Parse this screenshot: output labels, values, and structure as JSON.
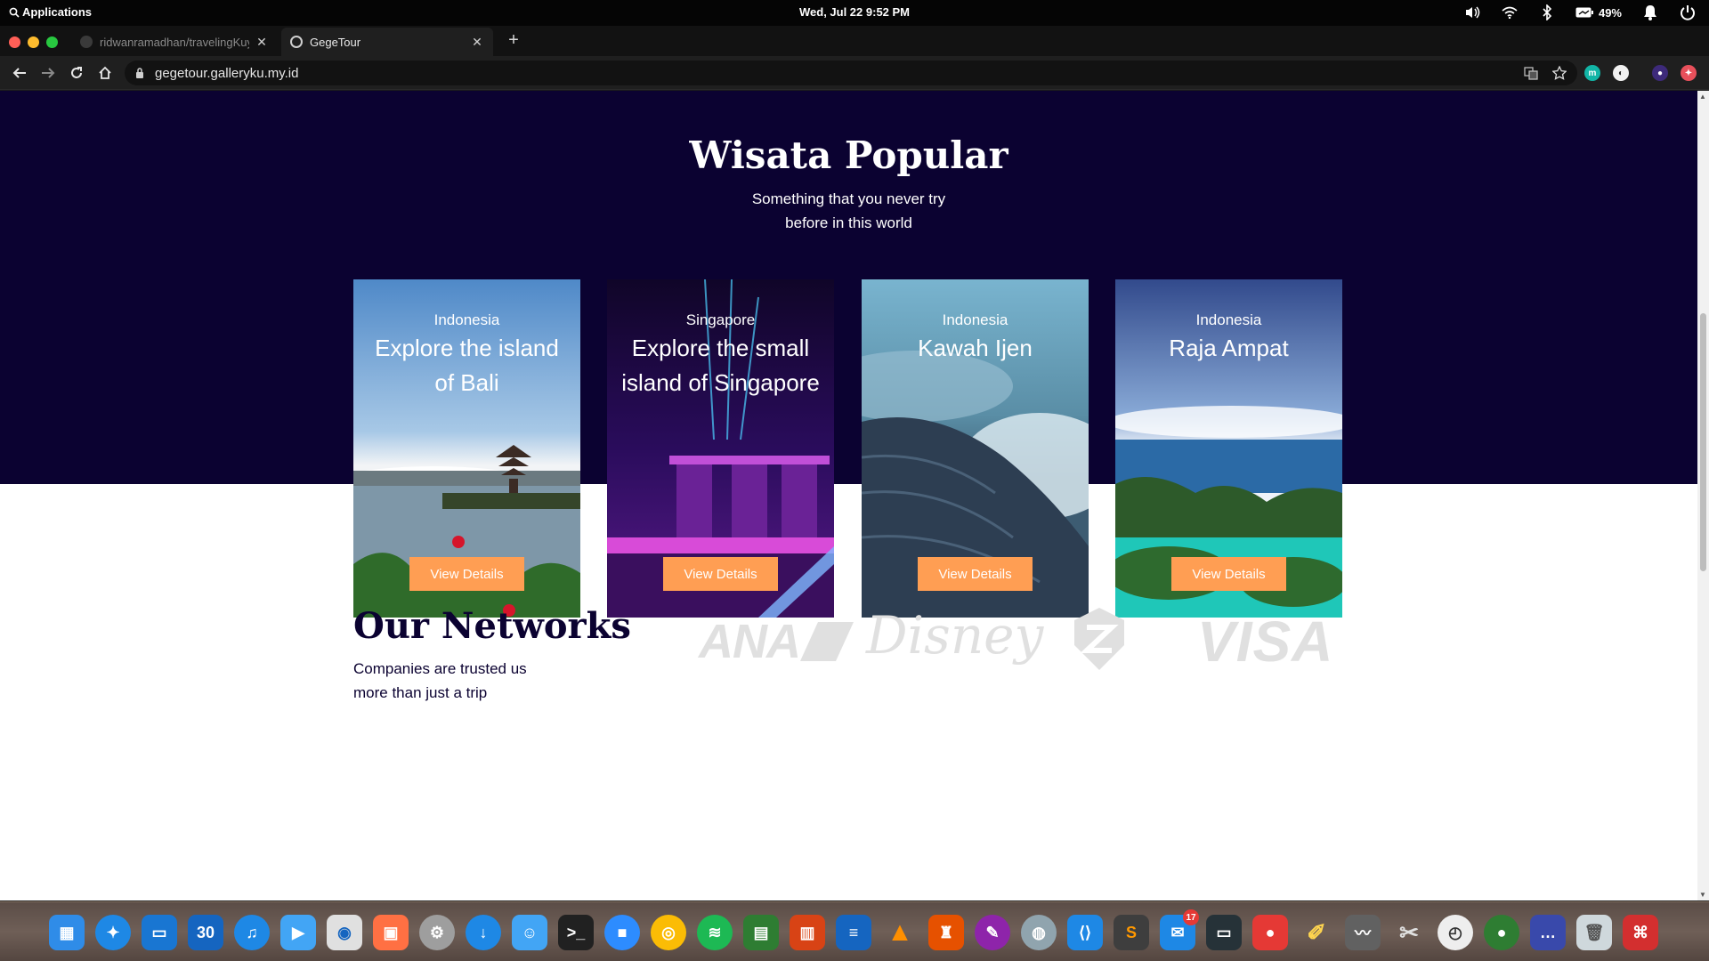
{
  "system_bar": {
    "apps_label": "Applications",
    "clock": "Wed, Jul 22    9:52 PM",
    "battery": "49%"
  },
  "tabs": [
    {
      "title": "ridwanramadhan/travelingKuy",
      "active": false
    },
    {
      "title": "GegeTour",
      "active": true
    }
  ],
  "address_bar": {
    "url": "gegetour.galleryku.my.id"
  },
  "popular": {
    "title": "Wisata Popular",
    "subtitle_line1": "Something that you never try",
    "subtitle_line2": "before in this world",
    "cards": [
      {
        "country": "Indonesia",
        "place": "Explore the island of Bali",
        "button": "View Details"
      },
      {
        "country": "Singapore",
        "place": "Explore the small island of Singapore",
        "button": "View Details"
      },
      {
        "country": "Indonesia",
        "place": "Kawah Ijen",
        "button": "View Details"
      },
      {
        "country": "Indonesia",
        "place": "Raja Ampat",
        "button": "View Details"
      }
    ]
  },
  "networks": {
    "title": "Our Networks",
    "subtitle_line1": "Companies are trusted us",
    "subtitle_line2": "more than just a trip",
    "logos": [
      "ANA",
      "Disney",
      "shield-logo",
      "VISA"
    ]
  },
  "dock": {
    "calendar_day": "30",
    "mail_badge": "17",
    "icons": [
      "finder-like-launcher-icon",
      "safari-icon",
      "notes-icon",
      "calendar-icon",
      "music-icon",
      "video-icon",
      "camera-icon",
      "presentation-icon",
      "settings-icon",
      "downloader-icon",
      "finder-icon",
      "terminal-icon",
      "zoom-icon",
      "chrome-icon",
      "spotify-icon",
      "spreadsheet-icon",
      "slides-icon",
      "writer-icon",
      "vlc-icon",
      "gitkraken-icon",
      "paint-icon",
      "disk-icon",
      "vscode-icon",
      "sublime-icon",
      "mail-icon",
      "screen-capture-icon",
      "record-icon",
      "brush-icon",
      "monitor-icon",
      "scissors-icon",
      "clock-icon",
      "globe-icon",
      "window-icon",
      "trash-icon",
      "pdf-icon"
    ]
  },
  "colors": {
    "hero_bg": "#0b0231",
    "accent_button": "#ff9e53",
    "logo_gray": "#e0e0e0"
  }
}
